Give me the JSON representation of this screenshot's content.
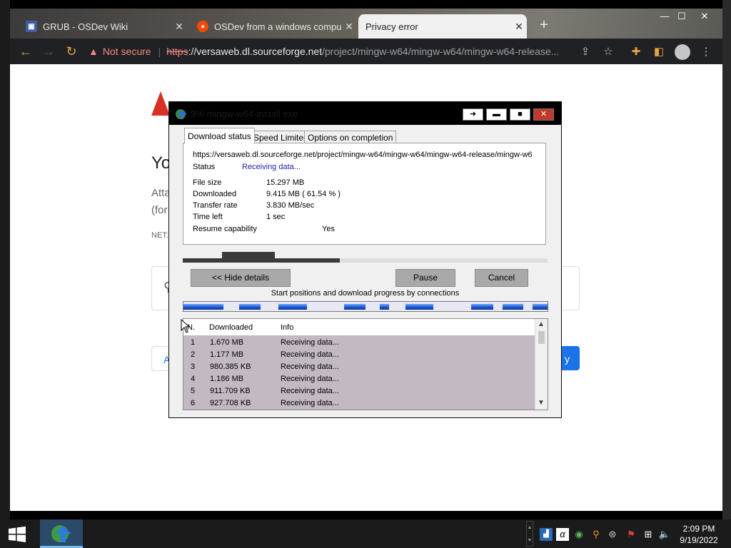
{
  "browser": {
    "tabs": [
      {
        "title": "GRUB - OSDev Wiki",
        "favicon": "osdev-favicon",
        "close": "✕"
      },
      {
        "title": "OSDev from a windows computer",
        "favicon": "reddit-favicon",
        "close": "✕"
      },
      {
        "title": "Privacy error",
        "favicon": "",
        "close": "✕"
      }
    ],
    "new_tab": "+",
    "window_controls": {
      "minimize": "—",
      "maximize": "☐",
      "close": "✕"
    },
    "omnibox": {
      "security_label": "Not secure",
      "scheme": "https",
      "host": "://versaweb.dl.sourceforge.net",
      "path": "/project/mingw-w64/mingw-w64/mingw-w64-release..."
    }
  },
  "page": {
    "heading_fragment": "Yo",
    "text_line1": "Atta",
    "text_line2": "(for",
    "neterr_fragment": "NET:",
    "advanced_button_fragment": "A",
    "back_button_fragment": "y"
  },
  "idm_dialog": {
    "title": "9% mingw-w64-install.exe",
    "title_buttons": {
      "minimize": "▬",
      "maximize": "■",
      "close": "✕"
    },
    "tabs": [
      "Download status",
      "Speed Limiter",
      "Options on completion"
    ],
    "url": "https://versaweb.dl.sourceforge.net/project/mingw-w64/mingw-w64/mingw-w64-release/mingw-w6",
    "fields": {
      "status_label": "Status",
      "status_value": "Receiving data...",
      "file_size_label": "File size",
      "file_size_value": "15.297  MB",
      "downloaded_label": "Downloaded",
      "downloaded_value": "9.415  MB  ( 61.54 % )",
      "transfer_rate_label": "Transfer rate",
      "transfer_rate_value": "3.830  MB/sec",
      "time_left_label": "Time left",
      "time_left_value": "1 sec",
      "resume_label": "Resume capability",
      "resume_value": "Yes"
    },
    "progress_fraction": 0.4314,
    "buttons": {
      "hide_details": "<< Hide details",
      "pause": "Pause",
      "cancel": "Cancel"
    },
    "connections_caption": "Start positions and download progress by connections",
    "connections_table": {
      "headers": [
        "N.",
        "Downloaded",
        "Info"
      ],
      "rows": [
        {
          "n": "1",
          "downloaded": "1.670  MB",
          "info": "Receiving data..."
        },
        {
          "n": "2",
          "downloaded": "1.177  MB",
          "info": "Receiving data..."
        },
        {
          "n": "3",
          "downloaded": "980.385  KB",
          "info": "Receiving data..."
        },
        {
          "n": "4",
          "downloaded": "1.186  MB",
          "info": "Receiving data..."
        },
        {
          "n": "5",
          "downloaded": "911.709  KB",
          "info": "Receiving data..."
        },
        {
          "n": "6",
          "downloaded": "927.708  KB",
          "info": "Receiving data..."
        }
      ]
    }
  },
  "taskbar": {
    "clock_time": "2:09 PM",
    "clock_date": "9/19/2022"
  },
  "colors": {
    "accent_blue": "#1a73e8",
    "not_secure_red": "#f28b82",
    "idm_row_bg": "#c3b9c3",
    "status_text_blue": "#1f1faa"
  }
}
